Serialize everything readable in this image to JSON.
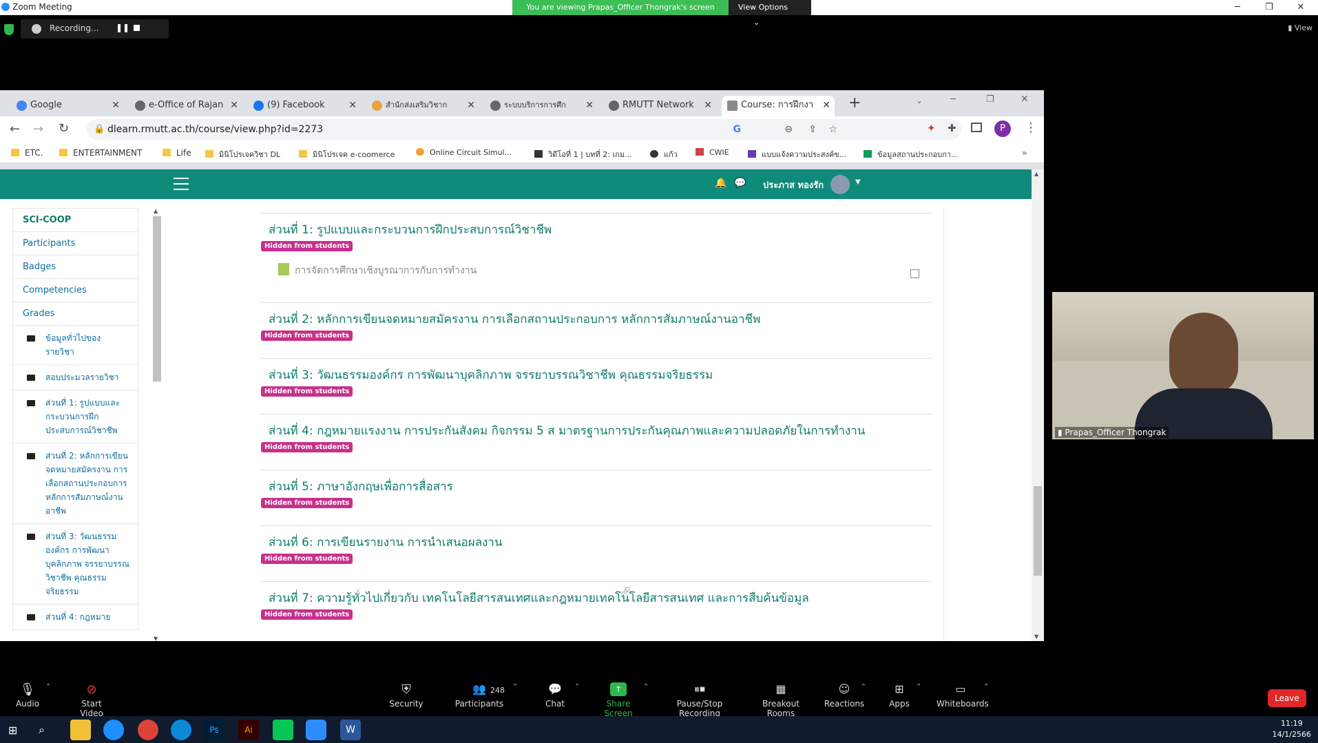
{
  "zoom": {
    "window_title": "Zoom Meeting",
    "viewing_banner": "You are viewing Prapas_Officer Thongrak's screen",
    "view_options": "View Options",
    "recording_label": "Recording...",
    "view_top": "View",
    "participant_count": "248",
    "video_name": "Prapas_Officer Thongrak",
    "controls": [
      "Audio",
      "Start Video",
      "Security",
      "Participants",
      "Chat",
      "Share Screen",
      "Pause/Stop Recording",
      "Breakout Rooms",
      "Reactions",
      "Apps",
      "Whiteboards"
    ],
    "leave": "Leave"
  },
  "browser": {
    "tabs": [
      "Google",
      "e-Office of Rajan",
      "(9) Facebook",
      "สำนักส่งเสริมวิชาก",
      "ระบบบริการการศึก",
      "RMUTT Network",
      "Course: การฝึกงา"
    ],
    "url": "dlearn.rmutt.ac.th/course/view.php?id=2273",
    "bookmarks": [
      "ETC.",
      "ENTERTAINMENT",
      "Life",
      "มินิโปรเจควิชา DL",
      "มินิโปรเจค e-coomerce",
      "Online Circuit Simul...",
      "วิดีโอที่ 1 | บทที่ 2: เกม...",
      "แก้ว",
      "CWIE",
      "แบบแจ้งความประสงค์ข...",
      "ข้อมูลสถานประกอบกา..."
    ]
  },
  "moodle": {
    "user_name": "ประภาส ทองรัก",
    "nav": {
      "course": "SCI-COOP",
      "items": [
        "Participants",
        "Badges",
        "Competencies",
        "Grades"
      ],
      "sections": [
        "ข้อมูลทั่วไปของรายวิชา",
        "สอบประมวลรายวิชา",
        "ส่วนที่ 1: รูปแบบและกระบวนการฝึกประสบการณ์วิชาชีพ",
        "ส่วนที่ 2: หลักการเขียนจดหมายสมัครงาน การเลือกสถานประกอบการ หลักการสัมภาษณ์งานอาชีพ",
        "ส่วนที่ 3: วัฒนธรรมองค์กร การพัฒนาบุคลิกภาพ จรรยาบรรณวิชาชีพ คุณธรรมจริยธรรม",
        "ส่วนที่ 4: กฎหมาย"
      ]
    },
    "hidden_badge": "Hidden from students",
    "activity_label": "การจัดการศึกษาเชิงบูรณาการกับการทำงาน",
    "sections": [
      "ส่วนที่ 1: รูปแบบและกระบวนการฝึกประสบการณ์วิชาชีพ",
      "ส่วนที่ 2: หลักการเขียนจดหมายสมัครงาน การเลือกสถานประกอบการ หลักการสัมภาษณ์งานอาชีพ",
      "ส่วนที่ 3: วัฒนธรรมองค์กร การพัฒนาบุคลิกภาพ จรรยาบรรณวิชาชีพ คุณธรรมจริยธรรม",
      "ส่วนที่ 4: กฎหมายแรงงาน การประกันสังคม กิจกรรม 5 ส มาตรฐานการประกันคุณภาพและความปลอดภัยในการทำงาน",
      "ส่วนที่ 5: ภาษาอังกฤษเพื่อการสื่อสาร",
      "ส่วนที่ 6: การเขียนรายงาน การนำเสนอผลงาน",
      "ส่วนที่ 7: ความรู้ทั่วไปเกี่ยวกับ เทคโนโลยีสารสนเทศและกฎหมายเทคโนโลยีสารสนเทศ และการสืบค้นข้อมูล"
    ]
  },
  "taskbar": {
    "time": "11:19",
    "date": "14/1/2566"
  }
}
